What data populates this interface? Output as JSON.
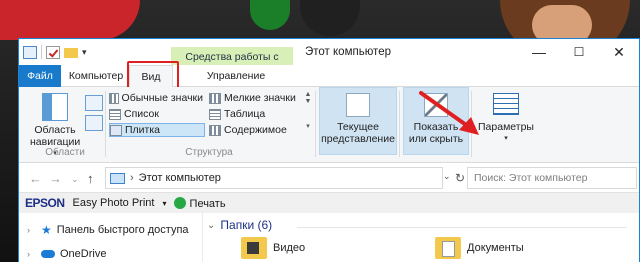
{
  "window": {
    "title": "Этот компьютер",
    "context_tab": "Средства работы с дисками",
    "controls": {
      "minimize": "—",
      "maximize": "☐",
      "close": "✕"
    }
  },
  "quick_access": {
    "dropdown": "▾"
  },
  "menu_tabs": {
    "file": "Файл",
    "computer": "Компьютер",
    "view": "Вид",
    "manage": "Управление"
  },
  "ribbon": {
    "panes": {
      "nav_pane_button": "Область навигации",
      "group_label": "Области"
    },
    "layout": {
      "items": [
        {
          "label": "Обычные значки",
          "selected": false
        },
        {
          "label": "Мелкие значки",
          "selected": false
        },
        {
          "label": "Список",
          "selected": false
        },
        {
          "label": "Таблица",
          "selected": false
        },
        {
          "label": "Плитка",
          "selected": true
        },
        {
          "label": "Содержимое",
          "selected": false
        }
      ],
      "group_label": "Структура"
    },
    "current_view": "Текущее представление",
    "show_hide": "Показать или скрыть",
    "options": "Параметры"
  },
  "address_bar": {
    "path": "Этот компьютер",
    "search_placeholder": "Поиск: Этот компьютер"
  },
  "epson_toolbar": {
    "brand": "EPSON",
    "app": "Easy Photo Print",
    "print": "Печать"
  },
  "nav_pane": {
    "items": [
      {
        "label": "Панель быстрого доступа",
        "icon": "star-icon"
      },
      {
        "label": "OneDrive",
        "icon": "cloud-icon"
      }
    ]
  },
  "content": {
    "group_title": "Папки (6)",
    "folders": [
      {
        "name": "Видео",
        "icon": "video-folder-icon"
      },
      {
        "name": "Документы",
        "icon": "documents-folder-icon"
      }
    ]
  },
  "colors": {
    "accent": "#1979ca",
    "context_tab_bg": "#d8efb8",
    "highlight_box": "#e02020",
    "annotation_arrow": "#e02020"
  }
}
